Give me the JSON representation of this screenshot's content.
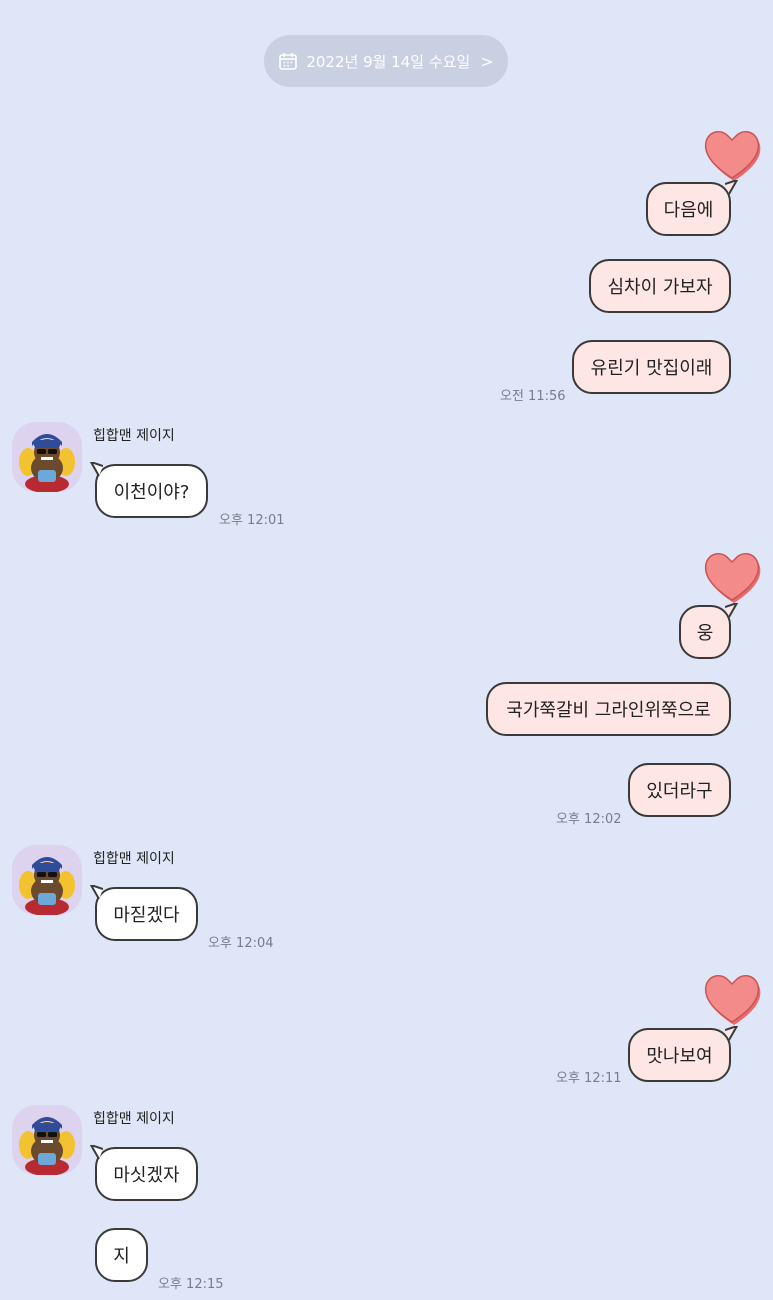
{
  "date_header": {
    "label": "2022년 9월 14일 수요일",
    "icon": "calendar-icon",
    "chevron": ">"
  },
  "colors": {
    "background": "#dfe6f7",
    "my_bubble": "#fde6e4",
    "their_bubble": "#ffffff",
    "heart": "#f07878"
  },
  "contact": {
    "name": "힙합맨 제이지"
  },
  "messages": [
    {
      "sender": "me",
      "text": "다음에",
      "reaction": "heart"
    },
    {
      "sender": "me",
      "text": "심차이 가보자"
    },
    {
      "sender": "me",
      "text": "유린기 맛집이래",
      "time": "오전 11:56"
    },
    {
      "sender": "contact",
      "name": "힙합맨 제이지",
      "text": "이천이야?",
      "time": "오후 12:01"
    },
    {
      "sender": "me",
      "text": "웅",
      "reaction": "heart"
    },
    {
      "sender": "me",
      "text": "국가쭉갈비 그라인위쭉으로"
    },
    {
      "sender": "me",
      "text": "있더라구",
      "time": "오후 12:02"
    },
    {
      "sender": "contact",
      "name": "힙합맨 제이지",
      "text": "마짇겠다",
      "time": "오후 12:04"
    },
    {
      "sender": "me",
      "text": "맛나보여",
      "reaction": "heart",
      "time": "오후 12:11"
    },
    {
      "sender": "contact",
      "name": "힙합맨 제이지",
      "text": "마싯겠자"
    },
    {
      "sender": "contact",
      "text": "지",
      "time": "오후 12:15"
    }
  ]
}
